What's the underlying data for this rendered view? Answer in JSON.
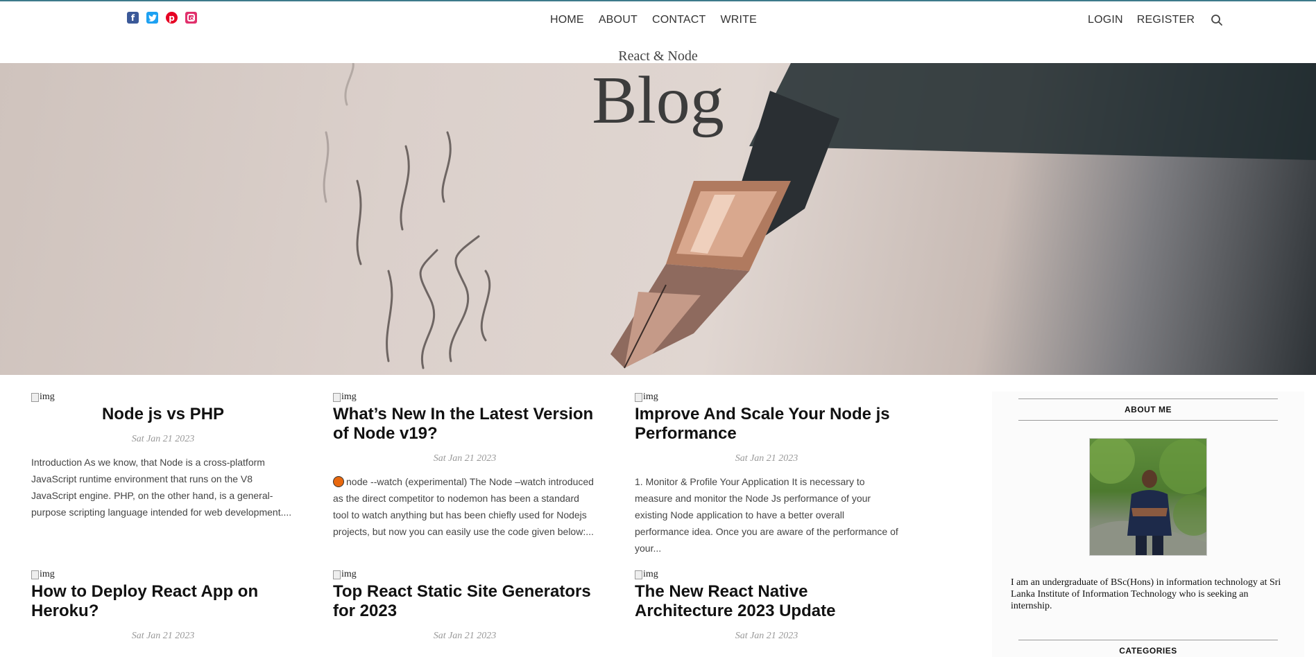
{
  "nav": {
    "social": [
      "facebook-icon",
      "twitter-icon",
      "pinterest-icon",
      "instagram-icon"
    ],
    "links": [
      "HOME",
      "ABOUT",
      "CONTACT",
      "WRITE"
    ],
    "auth": [
      "LOGIN",
      "REGISTER"
    ],
    "search_icon": "search-icon"
  },
  "header": {
    "subtitle": "React & Node",
    "title": "Blog"
  },
  "posts": [
    {
      "img_alt": "img",
      "title": "Node js vs PHP",
      "date": "Sat Jan 21 2023",
      "excerpt": "Introduction As we know, that Node is a cross-platform JavaScript runtime environment that runs on the V8 JavaScript engine. PHP, on the other hand, is a general-purpose scripting language intended for web development...."
    },
    {
      "img_alt": "img",
      "title": "What’s New In the Latest Version of Node v19?",
      "date": "Sat Jan 21 2023",
      "excerpt": "node --watch (experimental) The Node –watch introduced as the direct competitor to nodemon has been a standard tool to watch anything but has been chiefly used for Nodejs projects, but now you can easily use the code given below:..."
    },
    {
      "img_alt": "img",
      "title": "Improve And Scale Your Node js Performance",
      "date": "Sat Jan 21 2023",
      "excerpt": "1. Monitor & Profile Your Application It is necessary to measure and monitor the Node Js performance of your existing Node application to have a better overall performance idea. Once you are aware of the performance of your..."
    },
    {
      "img_alt": "img",
      "title": "How to Deploy React App on Heroku?",
      "date": "Sat Jan 21 2023"
    },
    {
      "img_alt": "img",
      "title": "Top React Static Site Generators for 2023",
      "date": "Sat Jan 21 2023"
    },
    {
      "img_alt": "img",
      "title": "The New React Native Architecture 2023 Update",
      "date": "Sat Jan 21 2023"
    }
  ],
  "sidebar": {
    "about_title": "ABOUT ME",
    "about_text": "I am an undergraduate of BSc(Hons) in information technology at Sri Lanka Institute of Information Technology who is seeking an internship.",
    "categories_title": "CATEGORIES"
  },
  "colors": {
    "accent_border": "#3d7a8a",
    "facebook": "#3b5998",
    "twitter": "#1da1f2",
    "pinterest": "#e60023",
    "instagram": "#e1306c"
  }
}
